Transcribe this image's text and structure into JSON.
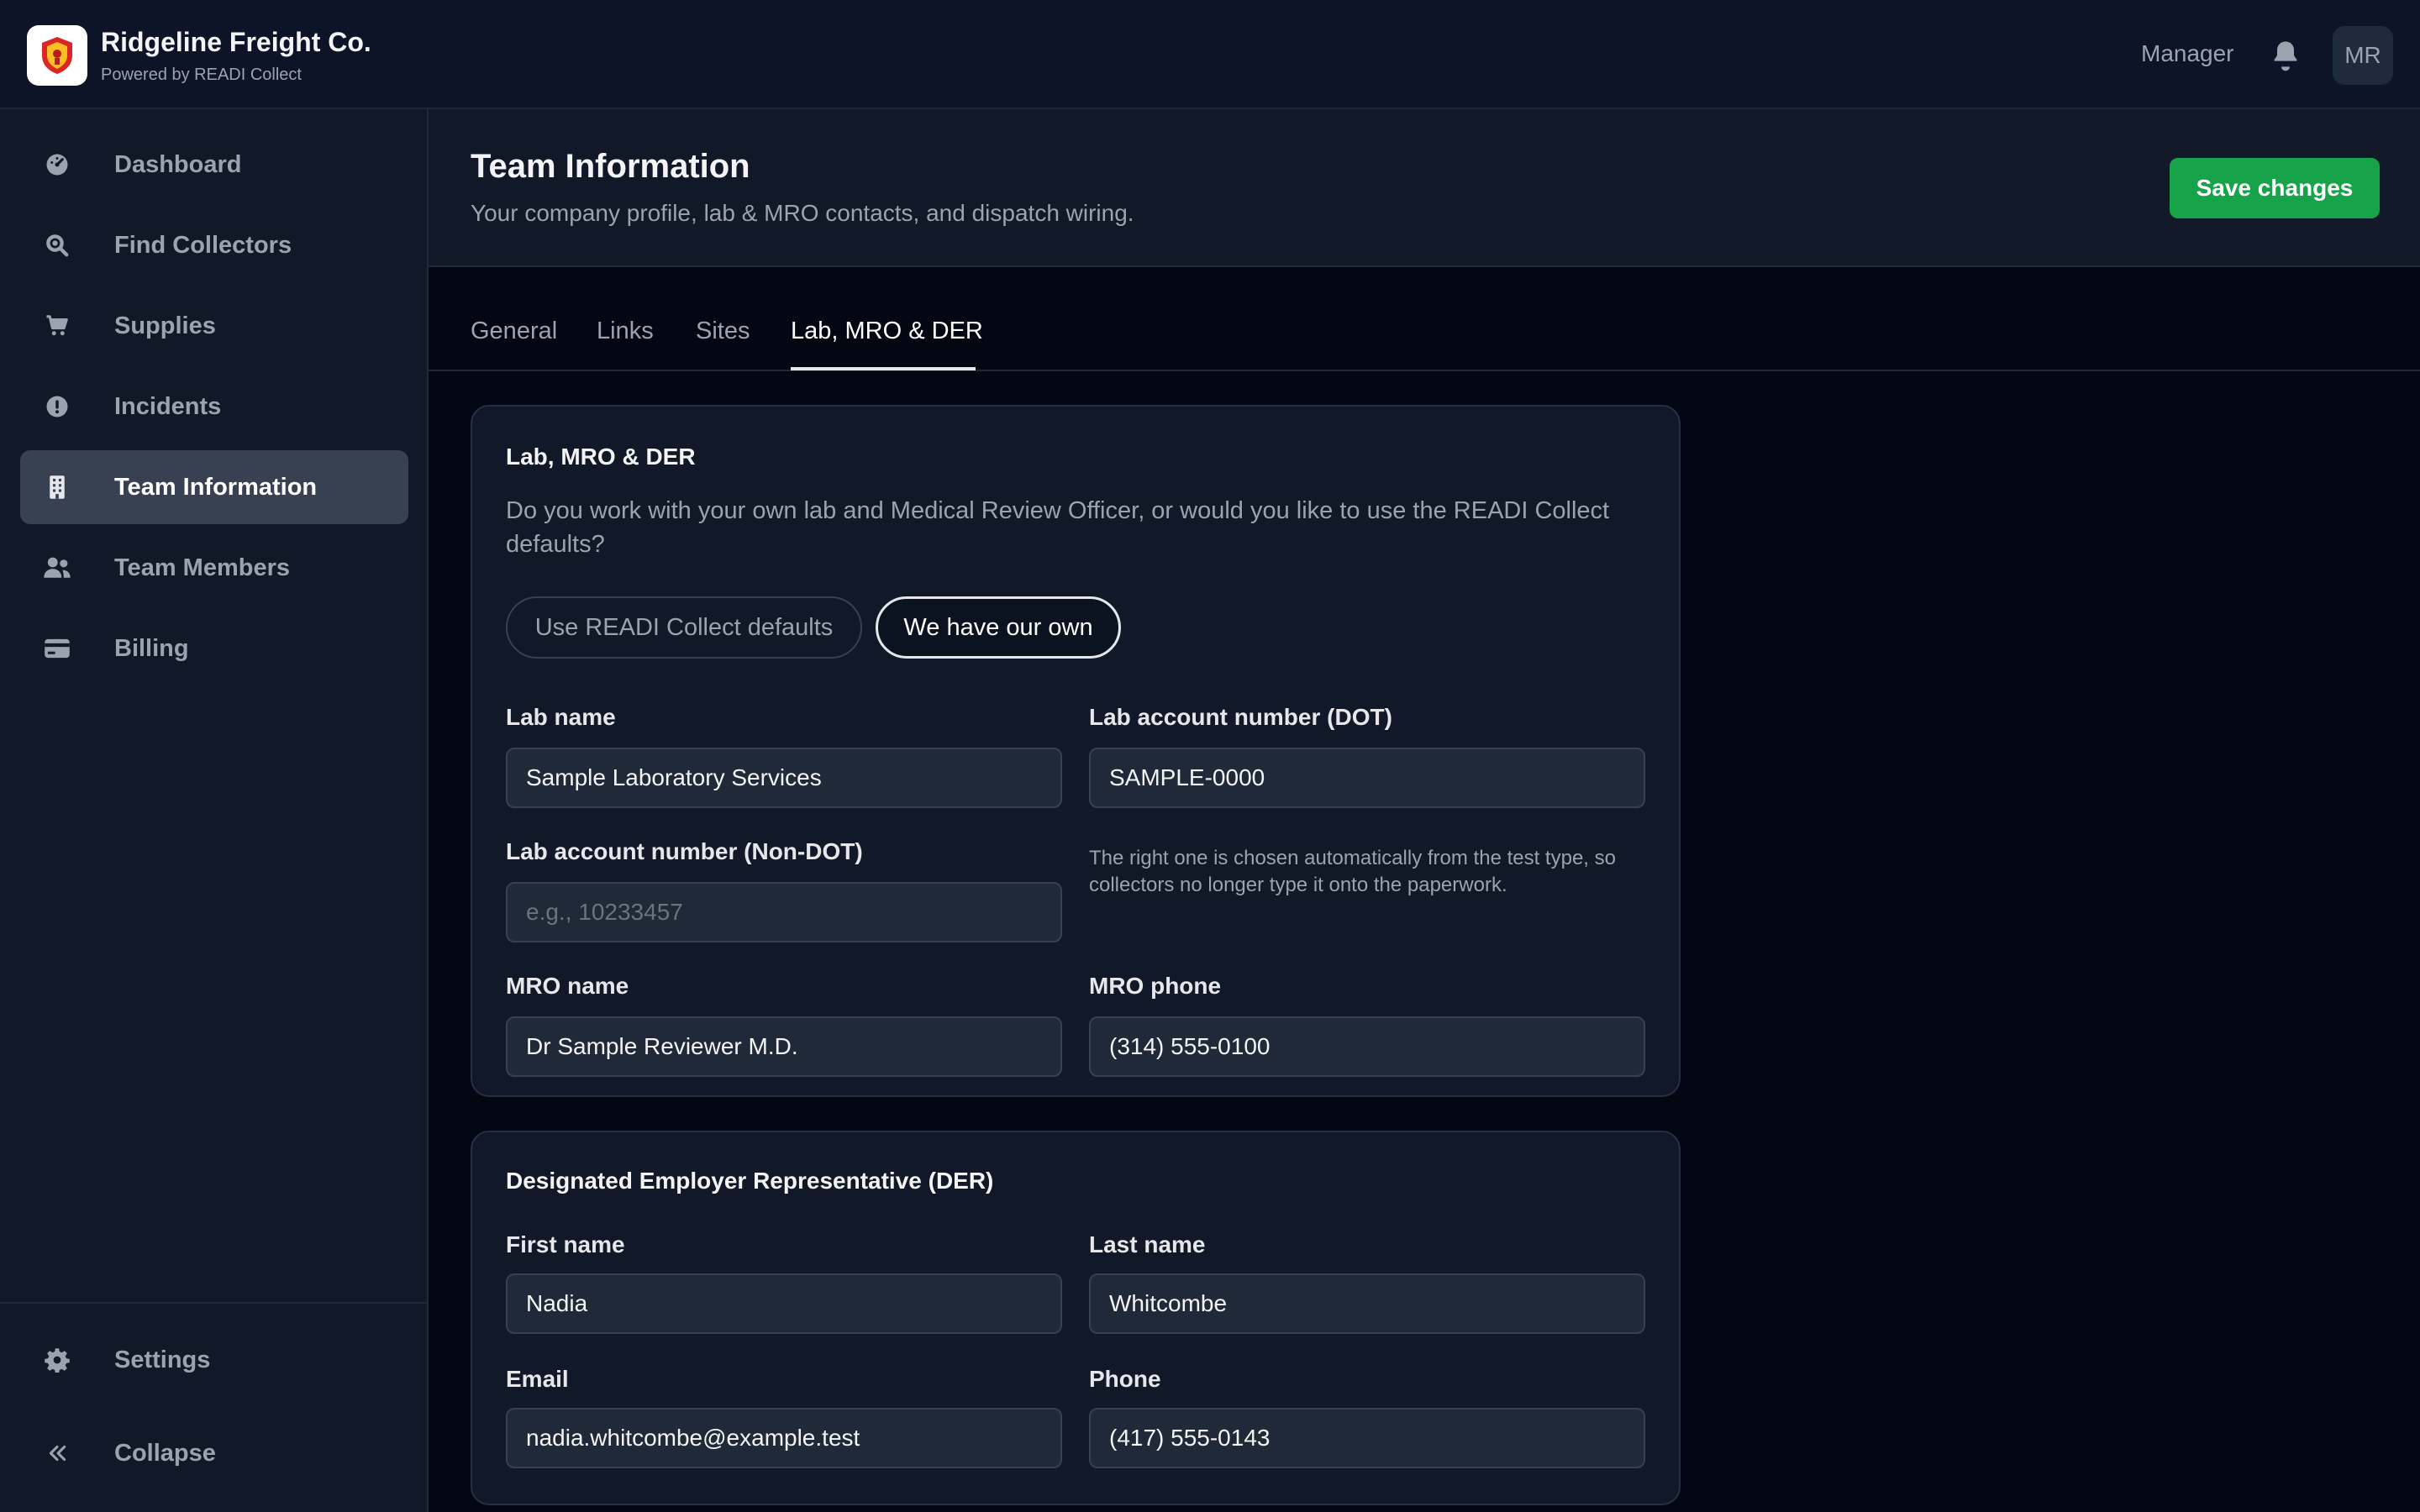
{
  "app": {
    "name": "Ridgeline Freight Co.",
    "powered_by": "Powered by READI Collect",
    "role": "Manager",
    "avatar_initials": "MR"
  },
  "sidebar": {
    "items": [
      {
        "label": "Dashboard",
        "icon": "dashboard-icon"
      },
      {
        "label": "Find Collectors",
        "icon": "search-icon"
      },
      {
        "label": "Supplies",
        "icon": "cart-icon"
      },
      {
        "label": "Incidents",
        "icon": "alert-icon"
      },
      {
        "label": "Team Information",
        "icon": "building-icon",
        "active": true
      },
      {
        "label": "Team Members",
        "icon": "users-icon"
      },
      {
        "label": "Billing",
        "icon": "credit-card-icon"
      }
    ],
    "footer": {
      "settings": "Settings",
      "collapse": "Collapse"
    }
  },
  "page": {
    "title": "Team Information",
    "subtitle": "Your company profile, lab & MRO contacts, and dispatch wiring.",
    "save_label": "Save changes"
  },
  "tabs": [
    {
      "label": "General"
    },
    {
      "label": "Links"
    },
    {
      "label": "Sites"
    },
    {
      "label": "Lab, MRO & DER",
      "active": true
    }
  ],
  "lab_card": {
    "title": "Lab, MRO & DER",
    "description": "Do you work with your own lab and Medical Review Officer, or would you like to use the READI Collect defaults?",
    "option_defaults": "Use READI Collect defaults",
    "option_own": "We have our own",
    "lab_name_label": "Lab name",
    "lab_name_value": "Sample Laboratory Services",
    "lab_dot_label": "Lab account number (DOT)",
    "lab_dot_value": "SAMPLE-0000",
    "lab_nondot_label": "Lab account number (Non-DOT)",
    "lab_nondot_placeholder": "e.g., 10233457",
    "lab_nondot_value": "",
    "account_hint": "The right one is chosen automatically from the test type, so collectors no longer type it onto the paperwork.",
    "mro_name_label": "MRO name",
    "mro_name_value": "Dr Sample Reviewer M.D.",
    "mro_phone_label": "MRO phone",
    "mro_phone_value": "(314) 555-0100"
  },
  "der_card": {
    "title": "Designated Employer Representative (DER)",
    "first_name_label": "First name",
    "first_name_value": "Nadia",
    "last_name_label": "Last name",
    "last_name_value": "Whitcombe",
    "email_label": "Email",
    "email_value": "nadia.whitcombe@example.test",
    "phone_label": "Phone",
    "phone_value": "(417) 555-0143"
  },
  "colors": {
    "accent": "#16a34a",
    "background": "#030712",
    "panel": "#111827"
  }
}
